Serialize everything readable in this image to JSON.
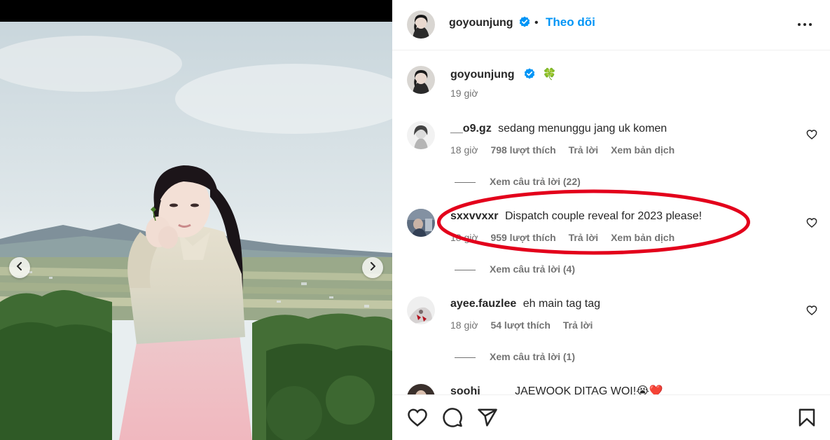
{
  "colors": {
    "accent": "#0095f6",
    "verified": "#0095f6",
    "secondary_text": "#737373",
    "annotation": "#e3001b"
  },
  "media": {
    "prev_icon": "chevron-left-icon",
    "next_icon": "chevron-right-icon"
  },
  "header": {
    "username": "goyounjung",
    "separator": "•",
    "follow_label": "Theo dõi",
    "more_icon": "more-horizontal-icon"
  },
  "caption": {
    "username": "goyounjung",
    "text": "🍀",
    "time": "19 giờ"
  },
  "comments": [
    {
      "username": "__o9.gz",
      "text": "sedang menunggu jang uk komen",
      "time": "18 giờ",
      "likes": "798 lượt thích",
      "reply_label": "Trả lời",
      "translate_label": "Xem bản dịch",
      "view_replies": "Xem câu trả lời (22)"
    },
    {
      "username": "sxxvvxxr",
      "text": "Dispatch couple reveal for 2023 please!",
      "time": "18 giờ",
      "likes": "959 lượt thích",
      "reply_label": "Trả lời",
      "translate_label": "Xem bản dịch",
      "view_replies": "Xem câu trả lời (4)"
    },
    {
      "username": "ayee.fauzlee",
      "text": "eh main tag tag",
      "time": "18 giờ",
      "likes": "54 lượt thích",
      "reply_label": "Trả lời",
      "view_replies": "Xem câu trả lời (1)"
    }
  ],
  "partial_comment": {
    "username": "soohj",
    "text": "JAEWOOK DITAG WOI!😭❤️"
  },
  "actions": {
    "like_icon": "heart-icon",
    "comment_icon": "comment-icon",
    "share_icon": "share-icon",
    "save_icon": "bookmark-icon"
  }
}
